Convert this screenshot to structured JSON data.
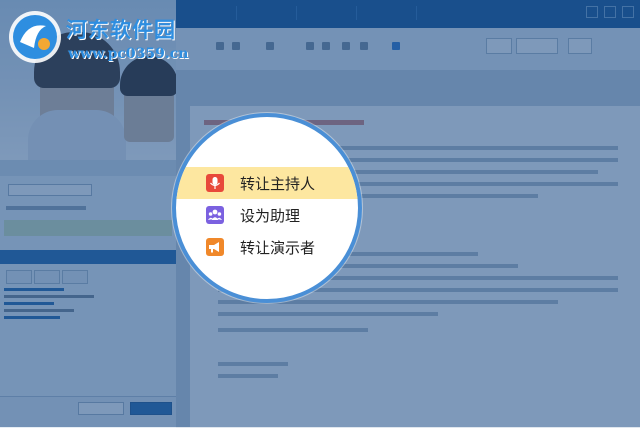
{
  "watermark": {
    "site_name": "河东软件园",
    "site_url": "www.pc0359.cn"
  },
  "context_menu": {
    "items": [
      {
        "label": "转让主持人",
        "icon": "microphone-icon",
        "color": "#e8493a",
        "active": true
      },
      {
        "label": "设为助理",
        "icon": "group-icon",
        "color": "#7b61e0",
        "active": false
      },
      {
        "label": "转让演示者",
        "icon": "megaphone-icon",
        "color": "#f0882a",
        "active": false
      }
    ]
  },
  "colors": {
    "overlay": "#14468299",
    "accent": "#2e8ee0",
    "highlight": "#fde7a0"
  }
}
